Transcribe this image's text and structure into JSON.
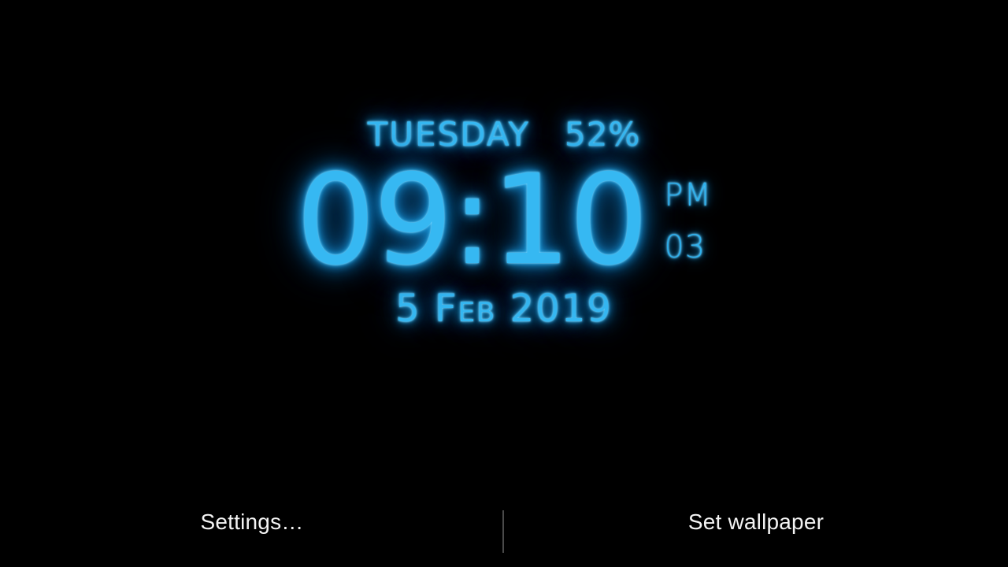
{
  "app": {
    "screen_name": "Live Wallpaper Preview",
    "background_color": "#000000"
  },
  "clock": {
    "accent_color": "#29ade4",
    "glow_color": "#1f9fe0",
    "day_of_week": "TUESDAY",
    "battery_percent": "52%",
    "time": "09:10",
    "hours": "09",
    "minutes": "10",
    "separator": ":",
    "meridiem": "PM",
    "seconds": "03",
    "date": "5 Feb 2019",
    "date_day": "5",
    "date_month": "Feb",
    "date_year": "2019"
  },
  "action_bar": {
    "settings_label": "Settings…",
    "set_wallpaper_label": "Set wallpaper",
    "text_color": "#f4f4f4",
    "divider_color": "#4a4a4a"
  }
}
